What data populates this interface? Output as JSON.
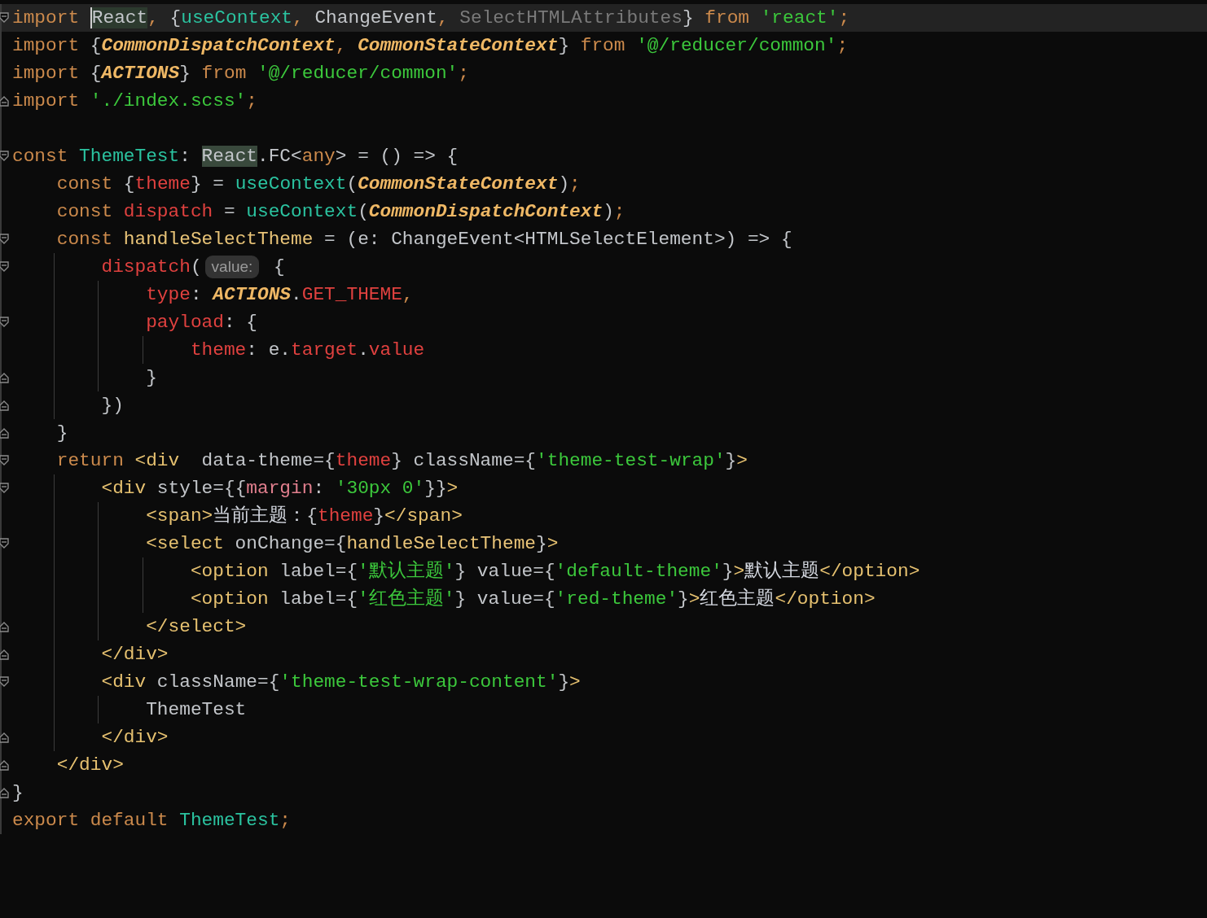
{
  "editor": {
    "lines": [
      {
        "current": true,
        "fold_start": true,
        "tokens": [
          {
            "text": "import ",
            "kind": "keyword"
          },
          {
            "text": "React",
            "kind": "plain",
            "caret": true,
            "highlight": true
          },
          {
            "text": ",",
            "kind": "keyword"
          },
          {
            "text": " {",
            "kind": "plain"
          },
          {
            "text": "useContext",
            "kind": "teal"
          },
          {
            "text": ",",
            "kind": "keyword"
          },
          {
            "text": " ChangeEvent",
            "kind": "plain"
          },
          {
            "text": ",",
            "kind": "keyword"
          },
          {
            "text": " SelectHTMLAttributes",
            "kind": "unused"
          },
          {
            "text": "} ",
            "kind": "plain"
          },
          {
            "text": "from ",
            "kind": "keyword"
          },
          {
            "text": "'react'",
            "kind": "string"
          },
          {
            "text": ";",
            "kind": "keyword"
          }
        ]
      },
      {
        "tokens": [
          {
            "text": "import ",
            "kind": "keyword"
          },
          {
            "text": "{",
            "kind": "plain"
          },
          {
            "text": "CommonDispatchContext",
            "kind": "class"
          },
          {
            "text": ", ",
            "kind": "keyword"
          },
          {
            "text": "CommonStateContext",
            "kind": "class"
          },
          {
            "text": "} ",
            "kind": "plain"
          },
          {
            "text": "from ",
            "kind": "keyword"
          },
          {
            "text": "'@/reducer/common'",
            "kind": "string"
          },
          {
            "text": ";",
            "kind": "keyword"
          }
        ]
      },
      {
        "tokens": [
          {
            "text": "import ",
            "kind": "keyword"
          },
          {
            "text": "{",
            "kind": "plain"
          },
          {
            "text": "ACTIONS",
            "kind": "class"
          },
          {
            "text": "} ",
            "kind": "plain"
          },
          {
            "text": "from ",
            "kind": "keyword"
          },
          {
            "text": "'@/reducer/common'",
            "kind": "string"
          },
          {
            "text": ";",
            "kind": "keyword"
          }
        ]
      },
      {
        "fold_end": true,
        "tokens": [
          {
            "text": "import ",
            "kind": "keyword"
          },
          {
            "text": "'./index.scss'",
            "kind": "string"
          },
          {
            "text": ";",
            "kind": "keyword"
          }
        ]
      },
      {
        "kind": "blank"
      },
      {
        "fold_start": true,
        "tokens": [
          {
            "text": "const ",
            "kind": "keyword"
          },
          {
            "text": "ThemeTest",
            "kind": "teal"
          },
          {
            "text": ": ",
            "kind": "plain"
          },
          {
            "text": "React",
            "kind": "plain",
            "highlight": true
          },
          {
            "text": ".FC<",
            "kind": "plain"
          },
          {
            "text": "any",
            "kind": "keyword"
          },
          {
            "text": "> = () => {",
            "kind": "plain"
          }
        ]
      },
      {
        "tokens": [
          {
            "text": "    const ",
            "kind": "keyword"
          },
          {
            "text": "{",
            "kind": "plain"
          },
          {
            "text": "theme",
            "kind": "red"
          },
          {
            "text": "} = ",
            "kind": "plain"
          },
          {
            "text": "useContext",
            "kind": "teal"
          },
          {
            "text": "(",
            "kind": "plain"
          },
          {
            "text": "CommonStateContext",
            "kind": "class"
          },
          {
            "text": ")",
            "kind": "plain"
          },
          {
            "text": ";",
            "kind": "keyword"
          }
        ]
      },
      {
        "tokens": [
          {
            "text": "    const ",
            "kind": "keyword"
          },
          {
            "text": "dispatch",
            "kind": "red"
          },
          {
            "text": " = ",
            "kind": "plain"
          },
          {
            "text": "useContext",
            "kind": "teal"
          },
          {
            "text": "(",
            "kind": "plain"
          },
          {
            "text": "CommonDispatchContext",
            "kind": "class"
          },
          {
            "text": ")",
            "kind": "plain"
          },
          {
            "text": ";",
            "kind": "keyword"
          }
        ]
      },
      {
        "fold_start": true,
        "tokens": [
          {
            "text": "    const ",
            "kind": "keyword"
          },
          {
            "text": "handleSelectTheme",
            "kind": "function"
          },
          {
            "text": " = (e: ChangeEvent<HTMLSelectElement>) => {",
            "kind": "plain"
          }
        ]
      },
      {
        "fold_start": true,
        "tokens": [
          {
            "text": "        dispatch",
            "kind": "red"
          },
          {
            "text": "(",
            "kind": "plain"
          },
          {
            "text": "value:",
            "kind": "hint"
          },
          {
            "text": " {",
            "kind": "plain"
          }
        ]
      },
      {
        "tokens": [
          {
            "text": "            type",
            "kind": "red"
          },
          {
            "text": ": ",
            "kind": "plain"
          },
          {
            "text": "ACTIONS",
            "kind": "class"
          },
          {
            "text": ".",
            "kind": "plain"
          },
          {
            "text": "GET_THEME",
            "kind": "red"
          },
          {
            "text": ",",
            "kind": "keyword"
          }
        ]
      },
      {
        "fold_start": true,
        "tokens": [
          {
            "text": "            payload",
            "kind": "red"
          },
          {
            "text": ": {",
            "kind": "plain"
          }
        ]
      },
      {
        "tokens": [
          {
            "text": "                theme",
            "kind": "red"
          },
          {
            "text": ": e.",
            "kind": "plain"
          },
          {
            "text": "target",
            "kind": "red"
          },
          {
            "text": ".",
            "kind": "plain"
          },
          {
            "text": "value",
            "kind": "red"
          }
        ]
      },
      {
        "fold_end": true,
        "tokens": [
          {
            "text": "            }",
            "kind": "plain"
          }
        ]
      },
      {
        "fold_end": true,
        "tokens": [
          {
            "text": "        })",
            "kind": "plain"
          }
        ]
      },
      {
        "fold_end": true,
        "tokens": [
          {
            "text": "    }",
            "kind": "plain"
          }
        ]
      },
      {
        "fold_start": true,
        "tokens": [
          {
            "text": "    return ",
            "kind": "keyword"
          },
          {
            "text": "<div",
            "kind": "tag"
          },
          {
            "text": "  data-theme={",
            "kind": "plain"
          },
          {
            "text": "theme",
            "kind": "red"
          },
          {
            "text": "} className={",
            "kind": "plain"
          },
          {
            "text": "'theme-test-wrap'",
            "kind": "string"
          },
          {
            "text": "}",
            "kind": "plain"
          },
          {
            "text": ">",
            "kind": "tag"
          }
        ]
      },
      {
        "fold_start": true,
        "tokens": [
          {
            "text": "        <div",
            "kind": "tag"
          },
          {
            "text": " style={{",
            "kind": "plain"
          },
          {
            "text": "margin",
            "kind": "pink"
          },
          {
            "text": ": ",
            "kind": "plain"
          },
          {
            "text": "'30px 0'",
            "kind": "string"
          },
          {
            "text": "}}",
            "kind": "plain"
          },
          {
            "text": ">",
            "kind": "tag"
          }
        ]
      },
      {
        "tokens": [
          {
            "text": "            <span>",
            "kind": "tag"
          },
          {
            "text": "当前主题：",
            "kind": "text"
          },
          {
            "text": "{",
            "kind": "plain"
          },
          {
            "text": "theme",
            "kind": "red"
          },
          {
            "text": "}",
            "kind": "plain"
          },
          {
            "text": "</span>",
            "kind": "tag"
          }
        ]
      },
      {
        "fold_start": true,
        "tokens": [
          {
            "text": "            <select",
            "kind": "tag"
          },
          {
            "text": " onChange={",
            "kind": "plain"
          },
          {
            "text": "handleSelectTheme",
            "kind": "function"
          },
          {
            "text": "}",
            "kind": "plain"
          },
          {
            "text": ">",
            "kind": "tag"
          }
        ]
      },
      {
        "tokens": [
          {
            "text": "                <option",
            "kind": "tag"
          },
          {
            "text": " label={",
            "kind": "plain"
          },
          {
            "text": "'默认主题'",
            "kind": "string"
          },
          {
            "text": "} value={",
            "kind": "plain"
          },
          {
            "text": "'default-theme'",
            "kind": "string"
          },
          {
            "text": "}",
            "kind": "plain"
          },
          {
            "text": ">",
            "kind": "tag"
          },
          {
            "text": "默认主题",
            "kind": "text"
          },
          {
            "text": "</option>",
            "kind": "tag"
          }
        ]
      },
      {
        "tokens": [
          {
            "text": "                <option",
            "kind": "tag"
          },
          {
            "text": " label={",
            "kind": "plain"
          },
          {
            "text": "'红色主题'",
            "kind": "string"
          },
          {
            "text": "} value={",
            "kind": "plain"
          },
          {
            "text": "'red-theme'",
            "kind": "string"
          },
          {
            "text": "}",
            "kind": "plain"
          },
          {
            "text": ">",
            "kind": "tag"
          },
          {
            "text": "红色主题",
            "kind": "text"
          },
          {
            "text": "</option>",
            "kind": "tag"
          }
        ]
      },
      {
        "fold_end": true,
        "tokens": [
          {
            "text": "            </select>",
            "kind": "tag"
          }
        ]
      },
      {
        "fold_end": true,
        "tokens": [
          {
            "text": "        </div>",
            "kind": "tag"
          }
        ]
      },
      {
        "fold_start": true,
        "tokens": [
          {
            "text": "        <div",
            "kind": "tag"
          },
          {
            "text": " className={",
            "kind": "plain"
          },
          {
            "text": "'theme-test-wrap-content'",
            "kind": "string"
          },
          {
            "text": "}",
            "kind": "plain"
          },
          {
            "text": ">",
            "kind": "tag"
          }
        ]
      },
      {
        "tokens": [
          {
            "text": "            ThemeTest",
            "kind": "plain"
          }
        ]
      },
      {
        "fold_end": true,
        "tokens": [
          {
            "text": "        </div>",
            "kind": "tag"
          }
        ]
      },
      {
        "fold_end": true,
        "tokens": [
          {
            "text": "    </div>",
            "kind": "tag"
          }
        ]
      },
      {
        "fold_end": true,
        "tokens": [
          {
            "text": "}",
            "kind": "plain"
          }
        ]
      },
      {
        "tokens": [
          {
            "text": "export default ",
            "kind": "keyword"
          },
          {
            "text": "ThemeTest",
            "kind": "teal"
          },
          {
            "text": ";",
            "kind": "keyword"
          }
        ]
      }
    ]
  }
}
